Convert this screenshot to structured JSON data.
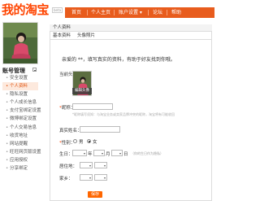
{
  "header": {
    "logo": "我的淘宝",
    "beta": "beta",
    "nav": [
      "首页",
      "个人主页",
      "账户设置 ▾",
      "论坛",
      "帮助"
    ]
  },
  "sidebar": {
    "title": "账号管理",
    "collapse_icon": "minus-icon",
    "items": [
      {
        "label": "安全设置",
        "active": false
      },
      {
        "label": "个人资料",
        "active": true
      },
      {
        "label": "隐私设置",
        "active": false
      },
      {
        "label": "个人成长信息",
        "active": false
      },
      {
        "label": "支付宝绑定设置",
        "active": false
      },
      {
        "label": "微博绑定设置",
        "active": false
      },
      {
        "label": "个人交易信息",
        "active": false
      },
      {
        "label": "收货地址",
        "active": false
      },
      {
        "label": "网站提醒",
        "active": false
      },
      {
        "label": "旺旺网页版设置",
        "active": false
      },
      {
        "label": "应用授权",
        "active": false
      },
      {
        "label": "分享绑定",
        "active": false
      }
    ]
  },
  "main": {
    "panel_title": "个人资料",
    "tabs": [
      "基本资料",
      "头像照片"
    ],
    "intro": "亲爱的 **，填写真实的资料，有助于好友找到你哦。",
    "avatar_label": "当前头像：",
    "edit_avatar_label": "编辑头像",
    "nickname_label": "昵称：",
    "nickname_hint": "*昵称填写须知：与淘宝业务或卖家品牌冲突的昵称，淘宝将有可能收回",
    "realname_label": "真实姓名：",
    "gender_label": "性别：",
    "gender_options": [
      "男",
      "女"
    ],
    "gender_selected": "女",
    "birthday_label": "生日：",
    "birthday_year": "年",
    "birthday_month": "月",
    "birthday_day": "日",
    "birthday_hint": "（你的生日作为隐私）",
    "location_label": "居住地：",
    "hometown_label": "家乡：",
    "save_label": "保存"
  }
}
